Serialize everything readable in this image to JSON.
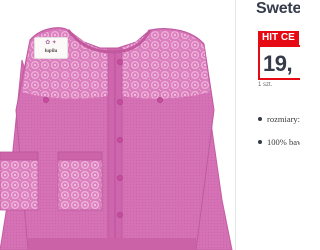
{
  "product": {
    "title": "Sweter",
    "image_alt": "Różowy sweter dziecięcy z koronką",
    "brand_tag": "lupilu",
    "colors": {
      "cardigan": "#d773b6",
      "cardigan_shadow": "#b9579b",
      "lace": "#e9a3d3",
      "button": "#c2489a",
      "price_red": "#e60a14",
      "text_dark": "#353b4b"
    }
  },
  "price": {
    "badge": "HIT CE",
    "value": "19,",
    "unit": "1 szt."
  },
  "features": [
    {
      "label": "rozmiary:"
    },
    {
      "label": "100% baw"
    }
  ]
}
